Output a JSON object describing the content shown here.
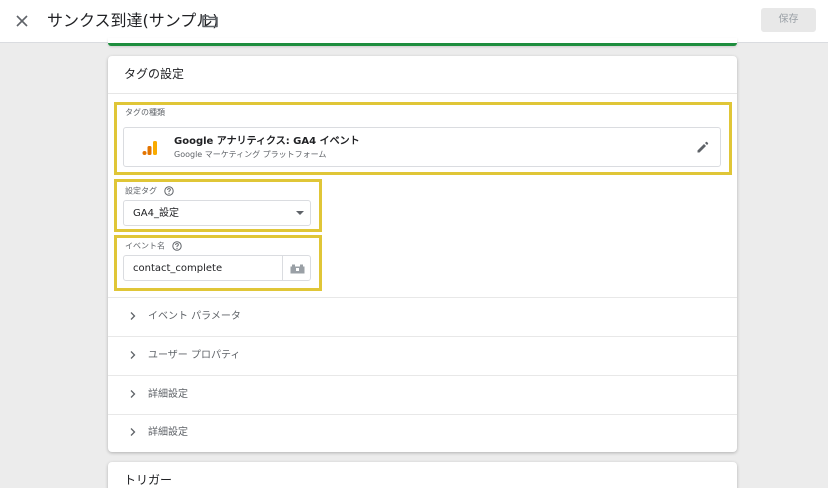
{
  "header": {
    "title": "サンクス到達(サンプル)",
    "save_label": "保存"
  },
  "card": {
    "title": "タグの設定",
    "tag_type": {
      "label": "タグの種類",
      "name": "Google アナリティクス: GA4 イベント",
      "subtitle": "Google マーケティング プラットフォーム"
    },
    "config_tag": {
      "label": "設定タグ",
      "value": "GA4_設定"
    },
    "event_name": {
      "label": "イベント名",
      "value": "contact_complete"
    },
    "sections": [
      {
        "label": "イベント パラメータ"
      },
      {
        "label": "ユーザー プロパティ"
      },
      {
        "label": "詳細設定"
      },
      {
        "label": "詳細設定"
      }
    ]
  },
  "trigger_card": {
    "title": "トリガー"
  },
  "colors": {
    "highlight": "#e0c637",
    "accent_green": "#1e8e3e",
    "ga_orange": "#f9ab00",
    "ga_dark_orange": "#e37400"
  },
  "icons": [
    "close-icon",
    "folder-icon",
    "google-analytics-icon",
    "pencil-icon",
    "help-icon",
    "dropdown-arrow-icon",
    "variable-icon",
    "chevron-right-icon"
  ]
}
